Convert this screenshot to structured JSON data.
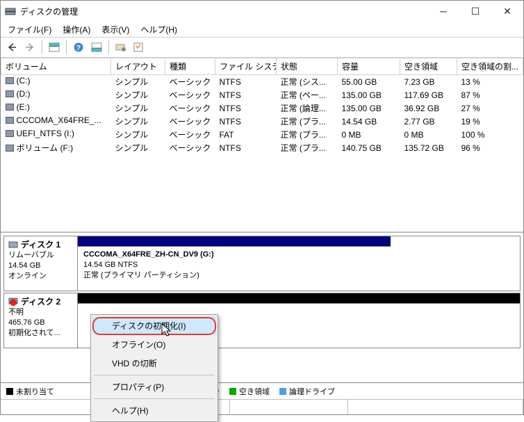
{
  "window": {
    "title": "ディスクの管理"
  },
  "menu": {
    "file": "ファイル(F)",
    "action": "操作(A)",
    "view": "表示(V)",
    "help": "ヘルプ(H)"
  },
  "columns": {
    "volume": "ボリューム",
    "layout": "レイアウト",
    "type": "種類",
    "fs": "ファイル システム",
    "status": "状態",
    "capacity": "容量",
    "free": "空き領域",
    "freepct": "空き領域の割..."
  },
  "volumes": [
    {
      "name": "(C:)",
      "layout": "シンプル",
      "type": "ベーシック",
      "fs": "NTFS",
      "status": "正常 (シス...",
      "capacity": "55.00 GB",
      "free": "7.23 GB",
      "pct": "13 %"
    },
    {
      "name": "(D:)",
      "layout": "シンプル",
      "type": "ベーシック",
      "fs": "NTFS",
      "status": "正常 (ペー...",
      "capacity": "135.00 GB",
      "free": "117.69 GB",
      "pct": "87 %"
    },
    {
      "name": "(E:)",
      "layout": "シンプル",
      "type": "ベーシック",
      "fs": "NTFS",
      "status": "正常 (論理...",
      "capacity": "135.00 GB",
      "free": "36.92 GB",
      "pct": "27 %"
    },
    {
      "name": "CCCOMA_X64FRE_...",
      "layout": "シンプル",
      "type": "ベーシック",
      "fs": "NTFS",
      "status": "正常 (プラ...",
      "capacity": "14.54 GB",
      "free": "2.77 GB",
      "pct": "19 %"
    },
    {
      "name": "UEFI_NTFS (I:)",
      "layout": "シンプル",
      "type": "ベーシック",
      "fs": "FAT",
      "status": "正常 (プラ...",
      "capacity": "0 MB",
      "free": "0 MB",
      "pct": "100 %"
    },
    {
      "name": "ボリューム (F:)",
      "layout": "シンプル",
      "type": "ベーシック",
      "fs": "NTFS",
      "status": "正常 (プラ...",
      "capacity": "140.75 GB",
      "free": "135.72 GB",
      "pct": "96 %"
    }
  ],
  "disk1": {
    "title": "ディスク 1",
    "kind": "リムーバブル",
    "size": "14.54 GB",
    "state": "オンライン",
    "part_name": "CCCOMA_X64FRE_ZH-CN_DV9  (G:)",
    "part_size": "14.54 GB NTFS",
    "part_status": "正常 (プライマリ パーティション)"
  },
  "disk2": {
    "title": "ディスク 2",
    "kind": "不明",
    "size": "465.76 GB",
    "state": "初期化されて..."
  },
  "legend": {
    "unalloc": "未割り当て",
    "primary": "ィション",
    "free": "空き領域",
    "logical": "論理ドライブ"
  },
  "ctx": {
    "init": "ディスクの初期化(I)",
    "offline": "オフライン(O)",
    "detach": "VHD の切断",
    "prop": "プロパティ(P)",
    "help": "ヘルプ(H)"
  }
}
